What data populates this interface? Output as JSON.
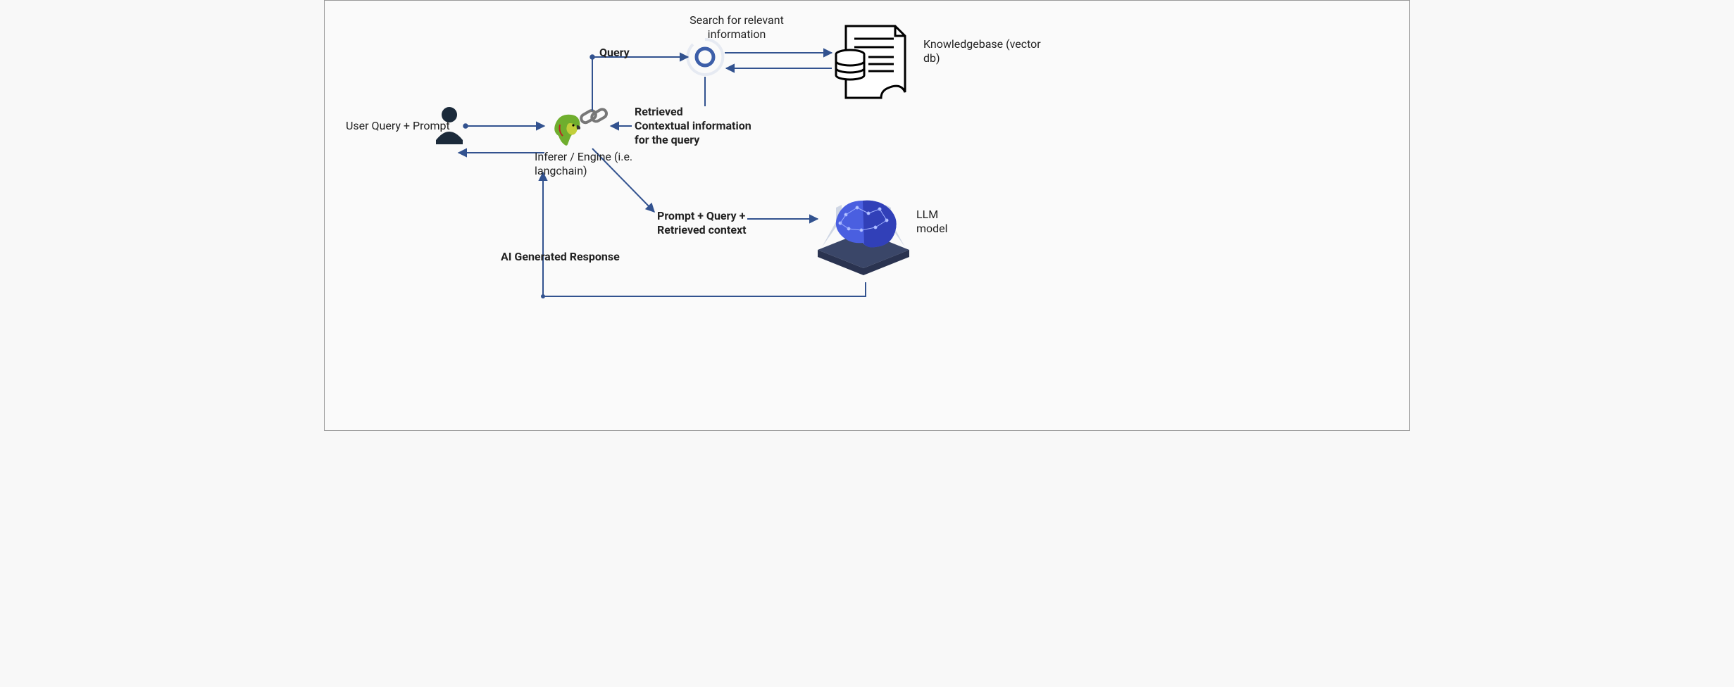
{
  "labels": {
    "user_query": "User Query + Prompt",
    "inferer_l1": "Inferer / Engine (i.e.",
    "inferer_l2": "langchain)",
    "query": "Query",
    "search_l1": "Search for relevant",
    "search_l2": "information",
    "retrieved_l1": "Retrieved",
    "retrieved_l2": "Contextual information",
    "retrieved_l3": "for the query",
    "kb_l1": "Knowledgebase (vector",
    "kb_l2": "db)",
    "prompt_l1": "Prompt + Query +",
    "prompt_l2": "Retrieved context",
    "llm_l1": "LLM",
    "llm_l2": "model",
    "ai_resp": "AI Generated Response"
  },
  "nodes": {
    "user": "User (person silhouette)",
    "engine": "Inference engine (parrot + chain-link icons)",
    "search": "Search loop (incomplete circle spinner)",
    "kb": "Knowledgebase (database cylinder on document)",
    "llm": "LLM model (brain on platform)"
  },
  "flows": [
    {
      "from": "user",
      "to": "engine",
      "label": "User Query + Prompt"
    },
    {
      "from": "engine",
      "to": "search",
      "label": "Query"
    },
    {
      "from": "search",
      "to": "kb",
      "label": ""
    },
    {
      "from": "kb",
      "to": "search",
      "label": ""
    },
    {
      "from": "search",
      "to": "engine",
      "label": "Retrieved Contextual information for the query"
    },
    {
      "from": "engine",
      "to": "llm",
      "label": "Prompt + Query + Retrieved context"
    },
    {
      "from": "llm",
      "to": "engine",
      "label": "AI Generated Response"
    },
    {
      "from": "engine",
      "to": "user",
      "label": ""
    }
  ],
  "colors": {
    "arrow": "#32528f",
    "text": "#212427",
    "accent": "#3d5fa9"
  }
}
